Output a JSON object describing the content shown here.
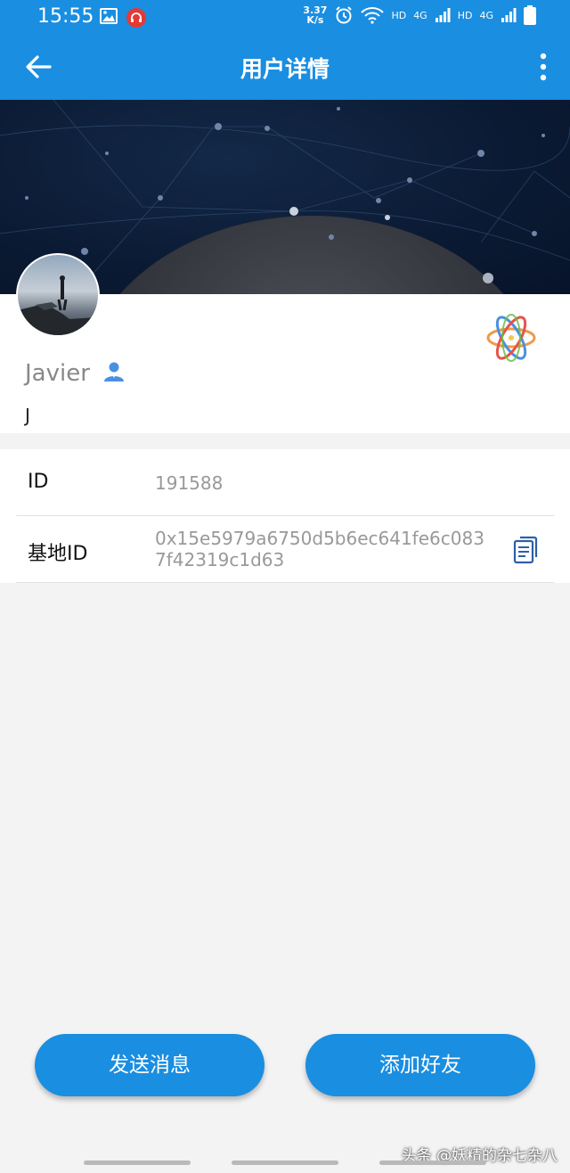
{
  "status_bar": {
    "time": "15:55",
    "net_speed_value": "3.37",
    "net_speed_unit": "K/s",
    "sim1_label": "HD",
    "sim1_net": "4G",
    "sim2_label": "HD",
    "sim2_net": "4G",
    "icons": [
      "gallery-icon",
      "headset-icon",
      "alarm-icon",
      "wifi-icon",
      "signal-icon",
      "battery-icon"
    ]
  },
  "app_bar": {
    "title": "用户详情",
    "back_icon": "arrow-left-icon",
    "more_icon": "more-vertical-icon"
  },
  "profile": {
    "name": "Javier",
    "subtitle": "J",
    "name_icon": "user-icon",
    "badge_icon": "atom-icon"
  },
  "info": {
    "rows": [
      {
        "label": "ID",
        "value": "191588"
      },
      {
        "label": "基地ID",
        "value": "0x15e5979a6750d5b6ec641fe6c0837f42319c1d63"
      }
    ]
  },
  "actions": {
    "send_message": "发送消息",
    "add_friend": "添加好友"
  },
  "watermark": "头条 @妖精的杂七杂八",
  "colors": {
    "primary": "#1a8ee1",
    "background": "#f3f3f3",
    "banner": "#0b1a33"
  }
}
